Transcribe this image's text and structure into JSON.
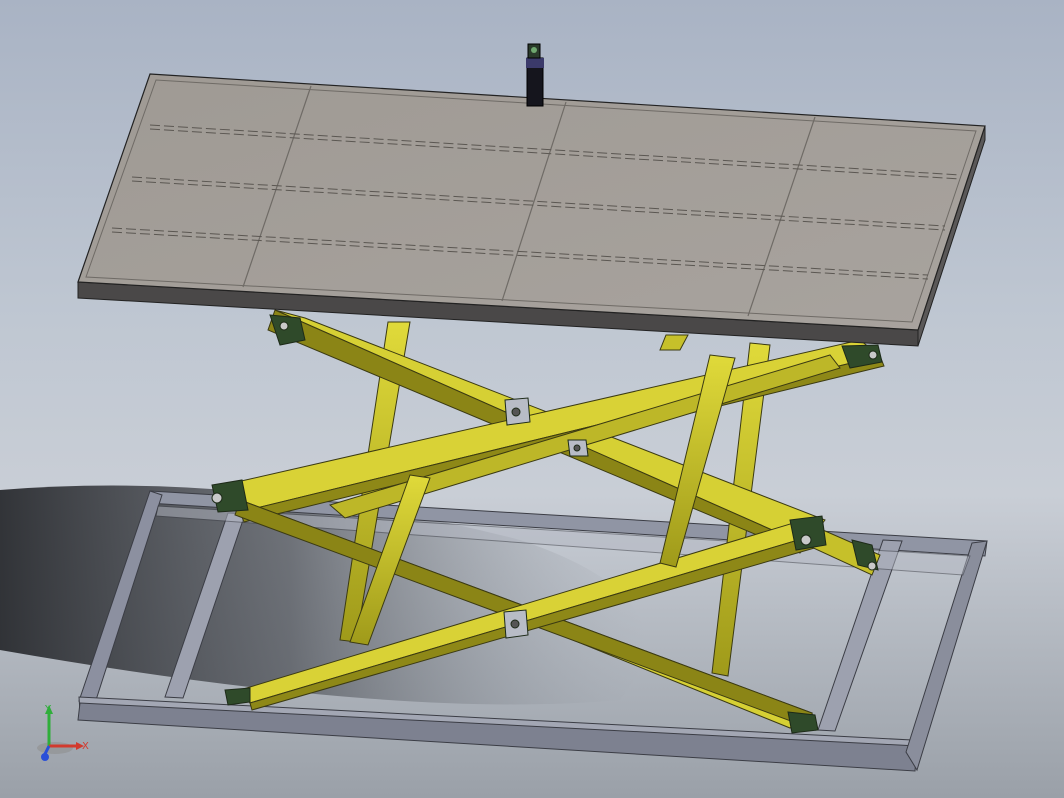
{
  "view": {
    "background_top": "#a9b3c4",
    "background_bottom": "#9aa0a8"
  },
  "model": {
    "platform_color": "#a39e98",
    "frame_color": "#8f93a3",
    "scissor_color": "#c8c228",
    "bracket_color": "#2f4a2a",
    "cylinder_color": "#1a1a24"
  },
  "triad": {
    "x_label": "X",
    "y_label": "Y",
    "x_color": "#d23a2e",
    "y_color": "#2fae3a",
    "z_color": "#2a4fd8"
  }
}
